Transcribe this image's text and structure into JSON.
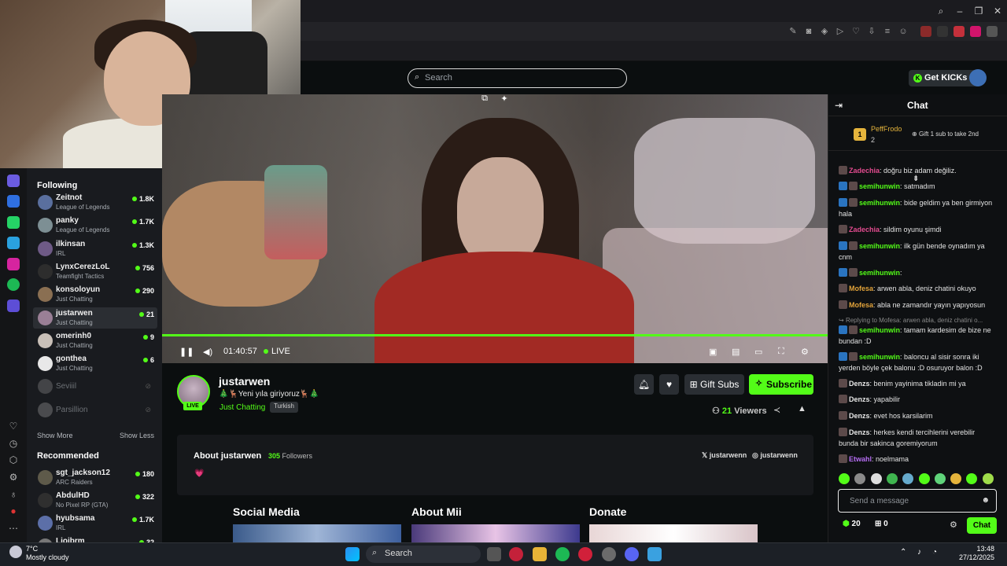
{
  "search": {
    "placeholder": "Search"
  },
  "header": {
    "get_kicks": "Get KICKs"
  },
  "sidebar": {
    "following_heading": "Following",
    "following": [
      {
        "name": "Zeitnot",
        "category": "League of Legends",
        "viewers": "1.8K",
        "online": true,
        "color": "#5a6f9e"
      },
      {
        "name": "panky",
        "category": "League of Legends",
        "viewers": "1.7K",
        "online": true,
        "color": "#7d8f94"
      },
      {
        "name": "ilkinsan",
        "category": "IRL",
        "viewers": "1.3K",
        "online": true,
        "color": "#6e5a86"
      },
      {
        "name": "LynxCerezLoL",
        "category": "Teamfight Tactics",
        "viewers": "756",
        "online": true,
        "color": "#2d2d2d"
      },
      {
        "name": "konsoloyun",
        "category": "Just Chatting",
        "viewers": "290",
        "online": true,
        "color": "#8a6f52"
      },
      {
        "name": "justarwen",
        "category": "Just Chatting",
        "viewers": "21",
        "online": true,
        "color": "#9a7f96"
      },
      {
        "name": "omerinh0",
        "category": "Just Chatting",
        "viewers": "9",
        "online": true,
        "color": "#c9c0b8"
      },
      {
        "name": "gonthea",
        "category": "Just Chatting",
        "viewers": "6",
        "online": true,
        "color": "#e8e8e8"
      },
      {
        "name": "Seviiil",
        "category": "",
        "viewers": "",
        "online": false,
        "color": "#777"
      },
      {
        "name": "Parsillion",
        "category": "",
        "viewers": "",
        "online": false,
        "color": "#888"
      }
    ],
    "show_more": "Show More",
    "show_less": "Show Less",
    "recommended_heading": "Recommended",
    "recommended": [
      {
        "name": "sgt_jackson12",
        "category": "ARC Raiders",
        "viewers": "180",
        "color": "#5e5a4a"
      },
      {
        "name": "AbdulHD",
        "category": "No Pixel RP (GTA)",
        "viewers": "322",
        "color": "#2f2f2f"
      },
      {
        "name": "hyubsama",
        "category": "IRL",
        "viewers": "1.7K",
        "color": "#5c6fa8"
      },
      {
        "name": "Lioibrm",
        "category": "",
        "viewers": "32",
        "color": "#777"
      }
    ]
  },
  "player": {
    "time": "01:40:57",
    "live_label": "LIVE",
    "progress": 1.0
  },
  "channel": {
    "name": "justarwen",
    "live_badge": "LIVE",
    "title": "🎄🦌Yeni yıla giriyoruz🦌🎄",
    "category": "Just Chatting",
    "language": "Turkish",
    "gift_subs": "Gift Subs",
    "subscribe": "Subscribe",
    "viewers": "21",
    "viewers_label": "Viewers"
  },
  "about": {
    "title": "About justarwen",
    "followers": "305",
    "followers_label": "Followers",
    "heart": "💗",
    "x_handle": "justarwenn",
    "instagram_handle": "justarwenn"
  },
  "panels": [
    "Social Media",
    "About Mii",
    "Donate"
  ],
  "chat": {
    "title": "Chat",
    "pinned_user": "PeffFrodo",
    "pinned_count": "2",
    "pinned_rank": "1",
    "pinned_gift": "Gift 1 sub to take 2nd",
    "messages": [
      {
        "user": "Zadechia",
        "text": "doğru biz adam değiliz.",
        "color": "#e24b8f"
      },
      {
        "user": "semihunwin",
        "text": "satmadım",
        "color": "#53fc18"
      },
      {
        "user": "semihunwin",
        "text": "bide geldim ya ben girmiyon hala",
        "color": "#53fc18"
      },
      {
        "user": "Zadechia",
        "text": "sildim oyunu şimdi",
        "color": "#e24b8f"
      },
      {
        "user": "semihunwin",
        "text": "ilk gün bende oynadım ya cnm",
        "color": "#53fc18"
      },
      {
        "user": "semihunwin",
        "text": "",
        "color": "#53fc18"
      },
      {
        "user": "Mofesa",
        "text": "arwen abla, deniz chatini okuyo",
        "color": "#e2a33a"
      },
      {
        "user": "Mofesa",
        "text": "abla ne zamandır yayın yapıyosun",
        "color": "#e2a33a"
      },
      {
        "user": "",
        "text": "Replying to Mofesa: arwen abla, deniz chatini o...",
        "color": "#888888"
      },
      {
        "user": "semihunwin",
        "text": "tamam kardesim de bize ne bundan :D",
        "color": "#53fc18"
      },
      {
        "user": "semihunwin",
        "text": "baloncu al sisir sonra iki yerden böyle çek balonu :D osuruyor balon :D",
        "color": "#53fc18"
      },
      {
        "user": "Denzs",
        "text": "benim yayinima tikladin mi ya",
        "color": "#e8e8e8"
      },
      {
        "user": "Denzs",
        "text": "yapabilir",
        "color": "#e8e8e8"
      },
      {
        "user": "Denzs",
        "text": "evet hos karsilarim",
        "color": "#e8e8e8"
      },
      {
        "user": "Denzs",
        "text": "herkes kendi tercihlerini verebilir bunda bir sakinca goremiyorum",
        "color": "#e8e8e8"
      },
      {
        "user": "Etwahl",
        "text": "noelmama",
        "color": "#b46cf0"
      }
    ],
    "input_placeholder": "Send a message",
    "points": "20",
    "gifts": "0",
    "send": "Chat"
  },
  "taskbar": {
    "temperature": "7°C",
    "weather": "Mostly cloudy",
    "search": "Search",
    "time": "13:48",
    "date": "27/12/2025"
  },
  "colors": {
    "accent": "#53fc18",
    "background": "#0b0e0f"
  }
}
